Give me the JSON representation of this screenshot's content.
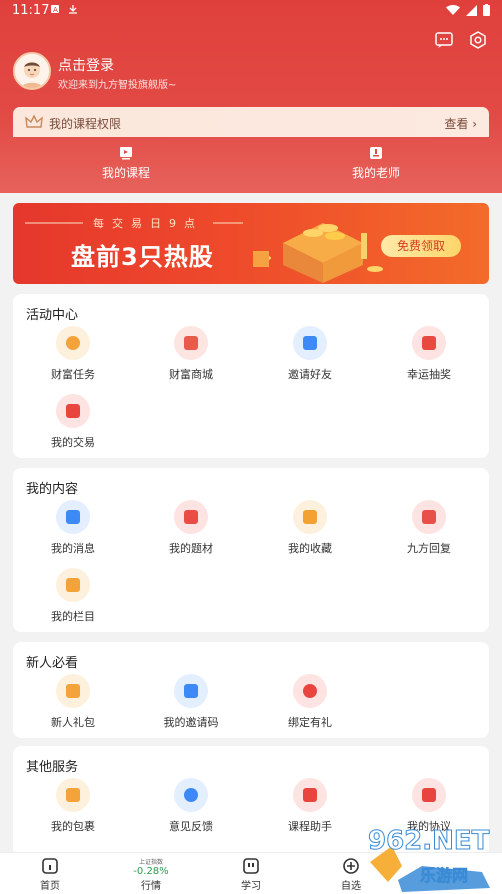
{
  "status": {
    "time": "11:17"
  },
  "profile": {
    "title": "点击登录",
    "subtitle": "欢迎来到九方智投旗舰版~"
  },
  "course_bar": {
    "label": "我的课程权限",
    "view": "查看 ›"
  },
  "tabs": [
    {
      "label": "我的课程"
    },
    {
      "label": "我的老师"
    }
  ],
  "banner": {
    "small": "每交易日9点",
    "big": "盘前3只热股",
    "button": "免费领取"
  },
  "sections": [
    {
      "title": "活动中心",
      "items": [
        {
          "label": "财富任务",
          "icon": "medal-icon",
          "color": "#f4a23a"
        },
        {
          "label": "财富商城",
          "icon": "store-icon",
          "color": "#ea5a4b"
        },
        {
          "label": "邀请好友",
          "icon": "invite-icon",
          "color": "#3d8af7"
        },
        {
          "label": "幸运抽奖",
          "icon": "gift-icon",
          "color": "#e84a3f"
        },
        {
          "label": "我的交易",
          "icon": "chart-icon",
          "color": "#e9453e"
        }
      ]
    },
    {
      "title": "我的内容",
      "items": [
        {
          "label": "我的消息",
          "icon": "message-icon",
          "color": "#3d8af7"
        },
        {
          "label": "我的题材",
          "icon": "topic-icon",
          "color": "#ea4c46"
        },
        {
          "label": "我的收藏",
          "icon": "star-icon",
          "color": "#f3a232"
        },
        {
          "label": "九方回复",
          "icon": "reply-icon",
          "color": "#e8514a"
        },
        {
          "label": "我的栏目",
          "icon": "column-icon",
          "color": "#f4a23a"
        }
      ]
    },
    {
      "title": "新人必看",
      "items": [
        {
          "label": "新人礼包",
          "icon": "package-icon",
          "color": "#f4a23a"
        },
        {
          "label": "我的邀请码",
          "icon": "code-icon",
          "color": "#3d8af7"
        },
        {
          "label": "绑定有礼",
          "icon": "heart-icon",
          "color": "#e8453e"
        }
      ]
    },
    {
      "title": "其他服务",
      "items": [
        {
          "label": "我的包裹",
          "icon": "parcel-icon",
          "color": "#f4a23a"
        },
        {
          "label": "意见反馈",
          "icon": "feedback-icon",
          "color": "#3d8af7"
        },
        {
          "label": "课程助手",
          "icon": "assistant-icon",
          "color": "#e8453e"
        },
        {
          "label": "我的协议",
          "icon": "agreement-icon",
          "color": "#e8453e"
        }
      ]
    }
  ],
  "bottom_nav": [
    {
      "label": "首页"
    },
    {
      "label": "行情",
      "index_name": "上证指数",
      "index_change": "-0.28%"
    },
    {
      "label": "学习"
    },
    {
      "label": "自选"
    }
  ],
  "watermark": {
    "text": "962.NET",
    "cn": "乐游网"
  }
}
